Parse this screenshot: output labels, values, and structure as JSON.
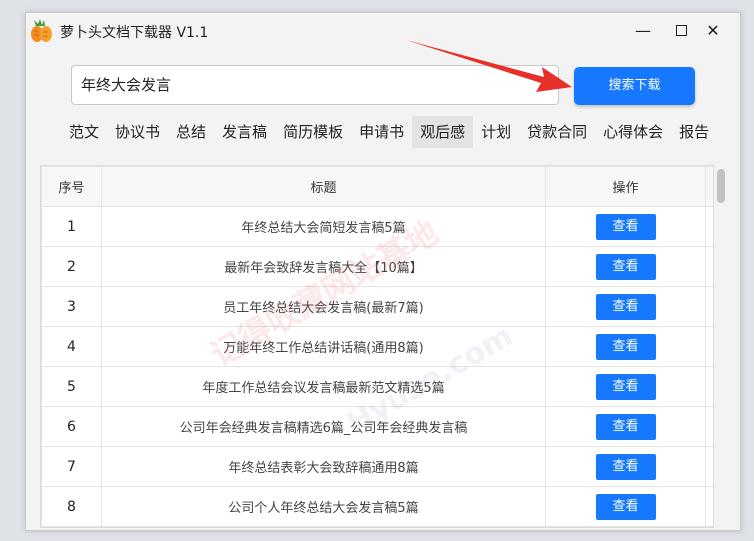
{
  "window": {
    "title": "萝卜头文档下载器  V1.1",
    "min_symbol": "—",
    "close_symbol": "✕"
  },
  "search": {
    "value": "年终大会发言",
    "button_label": "搜索下载"
  },
  "categories": [
    "范文",
    "协议书",
    "总结",
    "发言稿",
    "简历模板",
    "申请书",
    "观后感",
    "计划",
    "贷款合同",
    "心得体会",
    "报告"
  ],
  "active_category": "观后感",
  "table": {
    "headers": [
      "序号",
      "标题",
      "操作"
    ],
    "rows": [
      {
        "index": "1",
        "title": "年终总结大会简短发言稿5篇",
        "action": "查看"
      },
      {
        "index": "2",
        "title": "最新年会致辞发言稿大全【10篇】",
        "action": "查看"
      },
      {
        "index": "3",
        "title": "员工年终总结大会发言稿(最新7篇)",
        "action": "查看"
      },
      {
        "index": "4",
        "title": "万能年终工作总结讲话稿(通用8篇)",
        "action": "查看"
      },
      {
        "index": "5",
        "title": "年度工作总结会议发言稿最新范文精选5篇",
        "action": "查看"
      },
      {
        "index": "6",
        "title": "公司年会经典发言稿精选6篇_公司年会经典发言稿",
        "action": "查看"
      },
      {
        "index": "7",
        "title": "年终总结表彰大会致辞稿通用8篇",
        "action": "查看"
      },
      {
        "index": "8",
        "title": "公司个人年终总结大会发言稿5篇",
        "action": "查看"
      }
    ]
  },
  "watermark": {
    "text1": "记得收藏网站基地",
    "text2": "Hyuse.com"
  },
  "colors": {
    "accent": "#1677ff",
    "annotation_arrow": "#e8302a"
  },
  "icons": {
    "app": "carrot-icon",
    "arrow": "red-arrow-annotation"
  }
}
